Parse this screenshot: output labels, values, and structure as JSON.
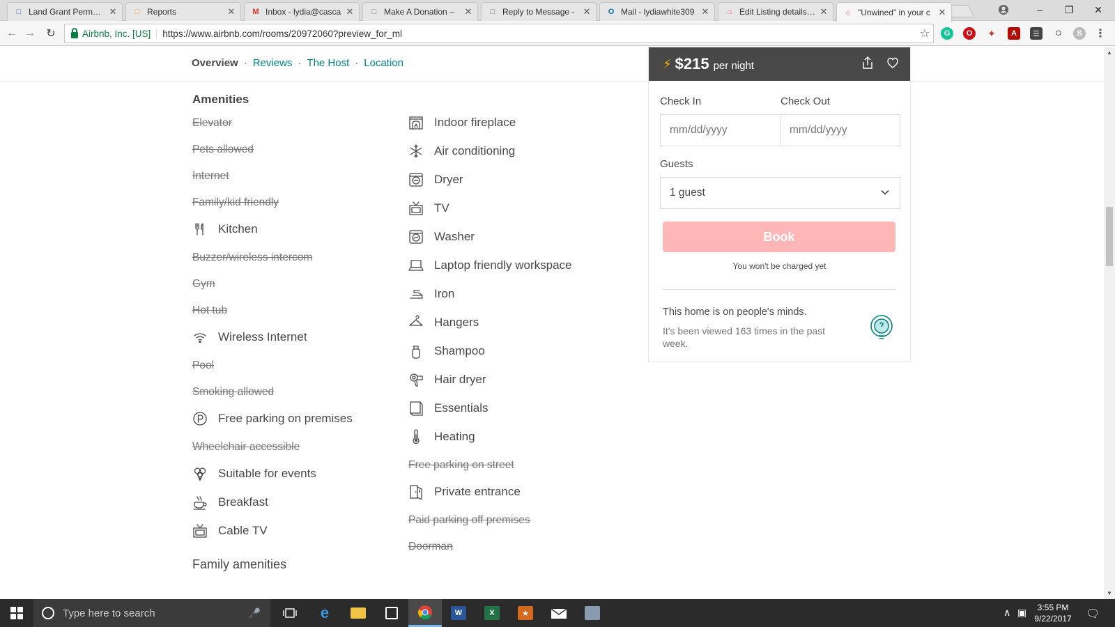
{
  "browser": {
    "tabs": [
      {
        "title": "Land Grant Permane",
        "icon": "land-grant-favicon",
        "color": "#3b7bd4"
      },
      {
        "title": "Reports",
        "icon": "reports-favicon",
        "color": "#f0a30a"
      },
      {
        "title": "Inbox - lydia@casca",
        "icon": "gmail-favicon",
        "color": "#d93025"
      },
      {
        "title": "Make A Donation –",
        "icon": "page-favicon",
        "color": "#777777"
      },
      {
        "title": "Reply to Message -",
        "icon": "page-favicon",
        "color": "#777777"
      },
      {
        "title": "Mail - lydiawhite309",
        "icon": "outlook-favicon",
        "color": "#0072c6"
      },
      {
        "title": "Edit Listing details fo",
        "icon": "airbnb-favicon",
        "color": "#ff5a5f"
      },
      {
        "title": "\"Unwined\" in your c",
        "icon": "airbnb-favicon",
        "color": "#ff5a5f"
      }
    ],
    "secure_label": "Airbnb, Inc. [US]",
    "url": "https://www.airbnb.com/rooms/20972060?preview_for_ml"
  },
  "subnav": {
    "overview": "Overview",
    "reviews": "Reviews",
    "host": "The Host",
    "location": "Location"
  },
  "amenities": {
    "title": "Amenities",
    "left": [
      {
        "label": "Elevator",
        "available": false
      },
      {
        "label": "Pets allowed",
        "available": false
      },
      {
        "label": "Internet",
        "available": false
      },
      {
        "label": "Family/kid friendly",
        "available": false
      },
      {
        "label": "Kitchen",
        "available": true,
        "icon": "kitchen-icon"
      },
      {
        "label": "Buzzer/wireless intercom",
        "available": false
      },
      {
        "label": "Gym",
        "available": false
      },
      {
        "label": "Hot tub",
        "available": false
      },
      {
        "label": "Wireless Internet",
        "available": true,
        "icon": "wifi-icon"
      },
      {
        "label": "Pool",
        "available": false
      },
      {
        "label": "Smoking allowed",
        "available": false
      },
      {
        "label": "Free parking on premises",
        "available": true,
        "icon": "parking-icon"
      },
      {
        "label": "Wheelchair accessible",
        "available": false
      },
      {
        "label": "Suitable for events",
        "available": true,
        "icon": "balloons-icon"
      },
      {
        "label": "Breakfast",
        "available": true,
        "icon": "coffee-cup-icon"
      },
      {
        "label": "Cable TV",
        "available": true,
        "icon": "tv-icon"
      }
    ],
    "right": [
      {
        "label": "Indoor fireplace",
        "available": true,
        "icon": "fireplace-icon"
      },
      {
        "label": "Air conditioning",
        "available": true,
        "icon": "snowflake-icon"
      },
      {
        "label": "Dryer",
        "available": true,
        "icon": "dryer-icon"
      },
      {
        "label": "TV",
        "available": true,
        "icon": "tv-icon"
      },
      {
        "label": "Washer",
        "available": true,
        "icon": "washer-icon"
      },
      {
        "label": "Laptop friendly workspace",
        "available": true,
        "icon": "laptop-icon"
      },
      {
        "label": "Iron",
        "available": true,
        "icon": "iron-icon"
      },
      {
        "label": "Hangers",
        "available": true,
        "icon": "hanger-icon"
      },
      {
        "label": "Shampoo",
        "available": true,
        "icon": "shampoo-icon"
      },
      {
        "label": "Hair dryer",
        "available": true,
        "icon": "hair-dryer-icon"
      },
      {
        "label": "Essentials",
        "available": true,
        "icon": "essentials-icon"
      },
      {
        "label": "Heating",
        "available": true,
        "icon": "thermometer-icon"
      },
      {
        "label": "Free parking on street",
        "available": false
      },
      {
        "label": "Private entrance",
        "available": true,
        "icon": "door-icon"
      },
      {
        "label": "Paid parking off premises",
        "available": false
      },
      {
        "label": "Doorman",
        "available": false
      }
    ],
    "family_title": "Family amenities"
  },
  "booking": {
    "price": "$215",
    "per_night": "per night",
    "check_in_label": "Check In",
    "check_out_label": "Check Out",
    "check_in_placeholder": "mm/dd/yyyy",
    "check_out_placeholder": "mm/dd/yyyy",
    "guests_label": "Guests",
    "guests_value": "1 guest",
    "book_label": "Book",
    "note": "You won't be charged yet",
    "mind_title": "This home is on people's minds.",
    "mind_desc": "It's been viewed 163 times in the past week.",
    "accent": "#008489",
    "book_color": "#ffb6b6"
  },
  "taskbar": {
    "search_placeholder": "Type here to search",
    "time": "3:55 PM",
    "date": "9/22/2017"
  }
}
